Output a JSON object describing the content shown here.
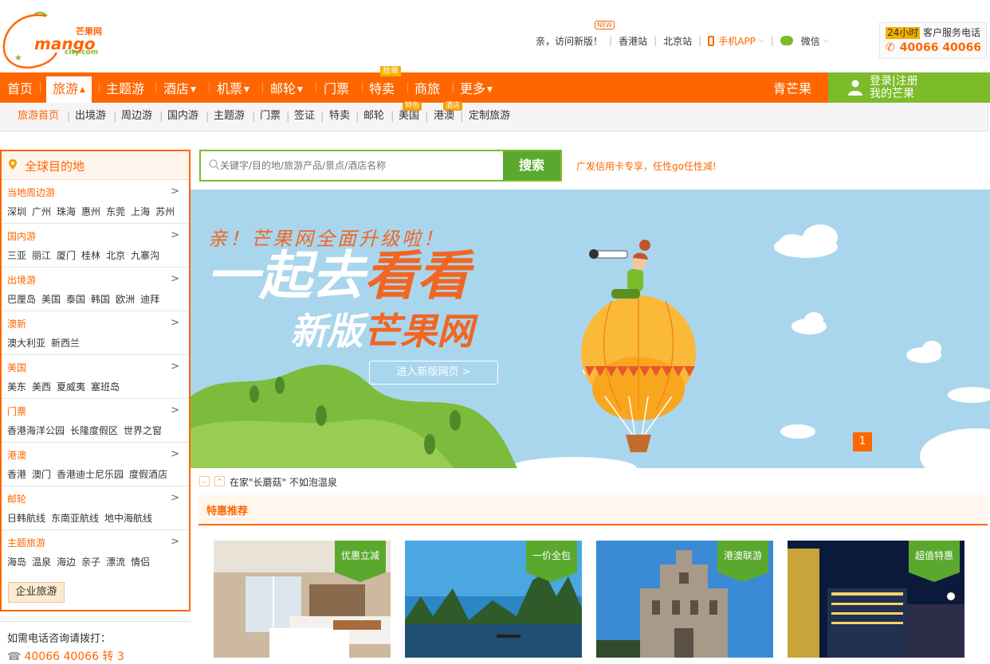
{
  "header": {
    "logo_cn": "芒果网",
    "logo_en": "mango",
    "logo_domain": "city.com",
    "new_badge": "NEW",
    "greeting": "亲，访问新版！",
    "site_hk": "香港站",
    "site_bj": "北京站",
    "app": "手机APP",
    "wechat": "微信",
    "service_24h": "24小时",
    "service_label": "客户服务电话",
    "service_phone": "40066 40066"
  },
  "nav": {
    "items": [
      "首页",
      "旅游",
      "主题游",
      "酒店",
      "机票",
      "邮轮",
      "门票",
      "特卖",
      "商旅",
      "更多"
    ],
    "badge_qiang": "抢单",
    "right_label": "青芒果",
    "login": "登录|注册",
    "my_mango": "我的芒果"
  },
  "subnav": {
    "items": [
      "旅游首页",
      "出境游",
      "周边游",
      "国内游",
      "主题游",
      "门票",
      "签证",
      "特卖",
      "邮轮",
      "美国",
      "港澳",
      "定制旅游"
    ],
    "tag_tese": "特色",
    "tag_jiudian": "酒店"
  },
  "sidebar": {
    "title": "全球目的地",
    "categories": [
      {
        "name": "当地周边游",
        "cities": [
          "深圳",
          "广州",
          "珠海",
          "惠州",
          "东莞",
          "上海",
          "苏州"
        ]
      },
      {
        "name": "国内游",
        "cities": [
          "三亚",
          "丽江",
          "厦门",
          "桂林",
          "北京",
          "九寨沟"
        ]
      },
      {
        "name": "出境游",
        "cities": [
          "巴厘岛",
          "美国",
          "泰国",
          "韩国",
          "欧洲",
          "迪拜"
        ]
      },
      {
        "name": "澳新",
        "cities": [
          "澳大利亚",
          "新西兰"
        ]
      },
      {
        "name": "美国",
        "cities": [
          "美东",
          "美西",
          "夏威夷",
          "塞班岛"
        ]
      },
      {
        "name": "门票",
        "cities": [
          "香港海洋公园",
          "长隆度假区",
          "世界之窗"
        ]
      },
      {
        "name": "港澳",
        "cities": [
          "香港",
          "澳门",
          "香港迪士尼乐园",
          "度假酒店"
        ]
      },
      {
        "name": "邮轮",
        "cities": [
          "日韩航线",
          "东南亚航线",
          "地中海航线"
        ]
      },
      {
        "name": "主题旅游",
        "cities": [
          "海岛",
          "温泉",
          "海边",
          "亲子",
          "漂流",
          "情侣"
        ]
      }
    ],
    "corporate_button": "企业旅游",
    "phone_label": "如需电话咨询请拨打：",
    "phone_number": "40066 40066 转 3"
  },
  "search": {
    "placeholder": "关键字/目的地/旅游产品/景点/酒店名称",
    "button": "搜索",
    "promo": "广发信用卡专享，任性go任性减!"
  },
  "banner": {
    "line1": "亲！芒果网全面升级啦！",
    "line2_white": "一起去",
    "line2_orange": "看看",
    "line3_white": "新版",
    "line3_orange": "芒果网",
    "cta": "进入新版网页 >",
    "page": "1"
  },
  "news": {
    "text": "在家\"长蘑菇\" 不如泡温泉"
  },
  "deals": {
    "title": "特惠推荐",
    "cards": [
      {
        "tag": "优惠立减",
        "scene": "hotel-room"
      },
      {
        "tag": "一价全包",
        "scene": "karst-river"
      },
      {
        "tag": "港澳联游",
        "scene": "ruins-of-st-paul"
      },
      {
        "tag": "超值特惠",
        "scene": "night-city"
      }
    ]
  },
  "colors": {
    "brand_orange": "#ff6600",
    "brand_green": "#7cbb2a",
    "banner_sky": "#a9d6ec"
  }
}
